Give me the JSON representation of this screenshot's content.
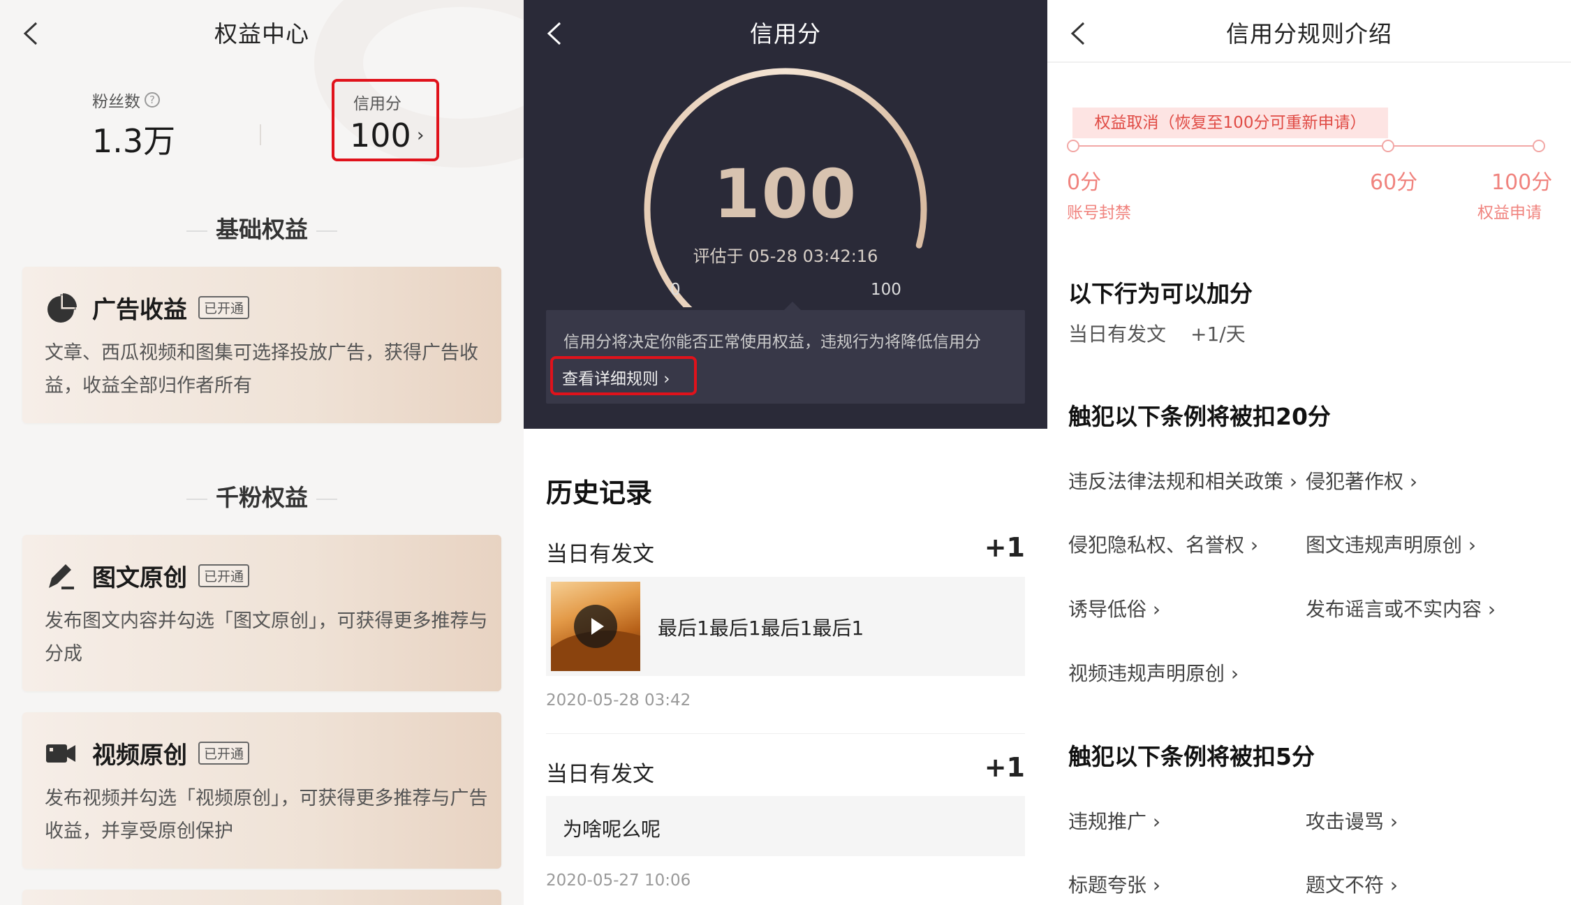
{
  "panel1": {
    "title": "权益中心",
    "fans": {
      "label": "粉丝数",
      "value": "1.3万"
    },
    "credit": {
      "label": "信用分",
      "value": "100"
    },
    "sections": [
      {
        "title": "基础权益"
      },
      {
        "title": "千粉权益"
      }
    ],
    "cards": [
      {
        "icon": "pie-chart-icon",
        "title": "广告收益",
        "badge": "已开通",
        "desc": "文章、西瓜视频和图集可选择投放广告，获得广告收益，收益全部归作者所有"
      },
      {
        "icon": "pen-icon",
        "title": "图文原创",
        "badge": "已开通",
        "desc": "发布图文内容并勾选「图文原创」，可获得更多推荐与分成"
      },
      {
        "icon": "video-camera-icon",
        "title": "视频原创",
        "badge": "已开通",
        "desc": "发布视频并勾选「视频原创」，可获得更多推荐与广告收益，并享受原创保护"
      }
    ]
  },
  "panel2": {
    "title": "信用分",
    "score": "100",
    "score_fraction": 1.0,
    "evaluated": "评估于 05-28 03:42:16",
    "gauge_min": "0",
    "gauge_max": "100",
    "notice": "信用分将决定你能否正常使用权益，违规行为将降低信用分",
    "rule_link": "查看详细规则 ›",
    "history_title": "历史记录",
    "records": [
      {
        "title": "当日有发文",
        "score": "+1",
        "content": "最后1最后1最后1最后1",
        "time": "2020-05-28 03:42",
        "has_thumb": true
      },
      {
        "title": "当日有发文",
        "score": "+1",
        "content": "为啥呢么呢",
        "time": "2020-05-27 10:06",
        "has_thumb": false
      }
    ]
  },
  "panel3": {
    "title": "信用分规则介绍",
    "cancel_chip": "权益取消（恢复至100分可重新申请）",
    "ticks": [
      {
        "score": "0分",
        "sub": "账号封禁"
      },
      {
        "score": "60分",
        "sub": ""
      },
      {
        "score": "100分",
        "sub": "权益申请"
      }
    ],
    "add_title": "以下行为可以加分",
    "add_item": "当日有发文",
    "add_rate": "+1/天",
    "deduct20_title": "触犯以下条例将被扣20分",
    "deduct20": [
      "违反法律法规和相关政策 ›",
      "侵犯著作权 ›",
      "侵犯隐私权、名誉权 ›",
      "图文违规声明原创 ›",
      "诱导低俗 ›",
      "发布谣言或不实内容 ›",
      "视频违规声明原创 ›"
    ],
    "deduct5_title": "触犯以下条例将被扣5分",
    "deduct5": [
      "违规推广 ›",
      "攻击谩骂 ›",
      "标题夸张 ›",
      "题文不符 ›"
    ]
  },
  "colors": {
    "accent_red": "#e0121b",
    "rule_pink": "#f0837e",
    "dark_bg": "#2a2a38",
    "gold": "#d8c3b0"
  }
}
